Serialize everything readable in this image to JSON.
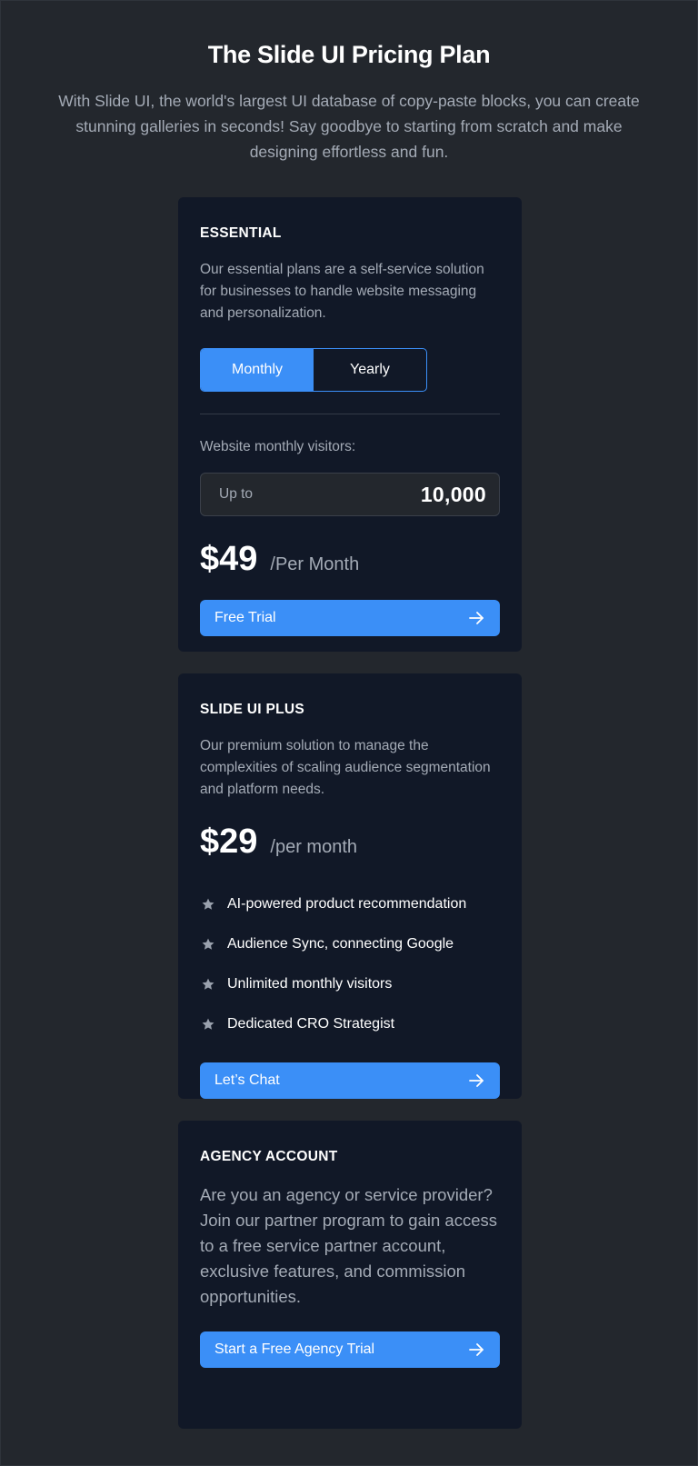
{
  "header": {
    "title": "The Slide UI Pricing Plan",
    "subtitle": "With Slide UI, the world's largest UI database of copy-paste blocks, you can create stunning galleries in seconds! Say goodbye to starting from scratch and make designing effortless and fun."
  },
  "essential": {
    "title": "ESSENTIAL",
    "description": "Our essential plans are a self-service solution for businesses to handle website messaging and personalization.",
    "toggle": {
      "monthly_label": "Monthly",
      "yearly_label": "Yearly",
      "selected": "Monthly"
    },
    "visitors_label": "Website monthly visitors:",
    "visitors_prefix": "Up to",
    "visitors_value": "10,000",
    "price": "$49",
    "price_period": "/Per Month",
    "cta_label": "Free Trial"
  },
  "plus": {
    "title": "SLIDE UI PLUS",
    "description": "Our premium solution to manage the complexities of scaling audience segmentation and platform needs.",
    "price": "$29",
    "price_period": "/per month",
    "features": [
      "AI-powered product recommendation",
      "Audience Sync, connecting Google",
      "Unlimited monthly visitors",
      "Dedicated CRO Strategist"
    ],
    "cta_label": "Let’s Chat"
  },
  "agency": {
    "title": "AGENCY ACCOUNT",
    "description": "Are you an agency or service provider? Join our partner program to gain access to a free service partner account, exclusive features, and commission opportunities.",
    "cta_label": "Start a Free Agency Trial"
  },
  "colors": {
    "background": "#23272d",
    "card": "#111827",
    "accent": "#3b8ff7",
    "muted_text": "#a4abb6"
  },
  "icons": {
    "cta": "arrow-right-icon",
    "feature": "star-icon"
  }
}
